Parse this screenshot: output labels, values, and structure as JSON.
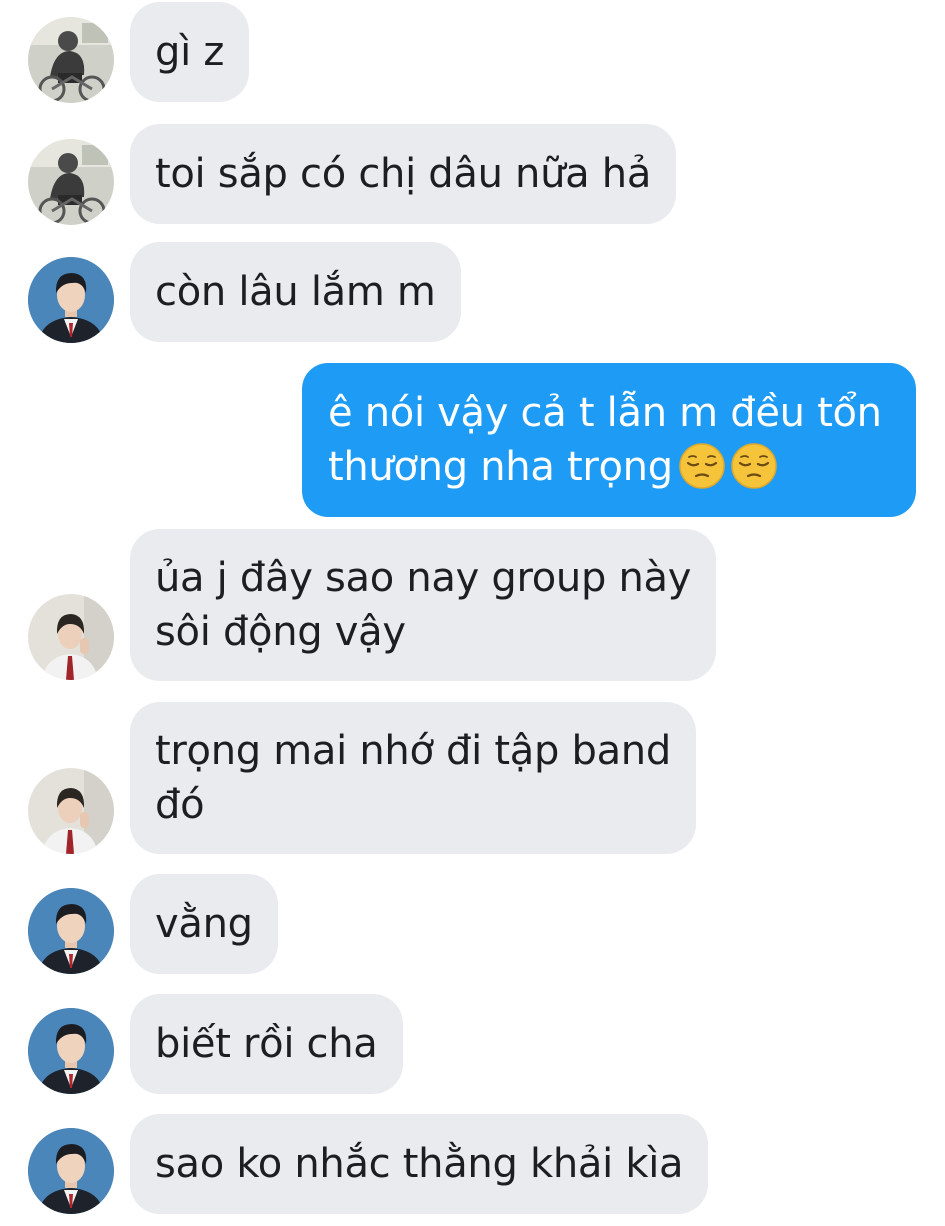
{
  "avatars": {
    "friend_biker": "biker-avatar",
    "trong": "trong-avatar",
    "friend_school": "student-avatar"
  },
  "colors": {
    "incoming_bubble": "#e9ebef",
    "outgoing_bubble": "#1e9cf5"
  },
  "messages": [
    {
      "sender": "friend_biker",
      "text": "gì z"
    },
    {
      "sender": "friend_biker",
      "text": "toi sắp có chị dâu nữa hả"
    },
    {
      "sender": "trong",
      "text": "còn lâu lắm m"
    },
    {
      "sender": "me",
      "lines": [
        "ê nói vậy cả t lẫn m đều tổn",
        "thương nha trọng"
      ],
      "emoji": [
        "pensive-face",
        "pensive-face"
      ]
    },
    {
      "sender": "friend_school",
      "lines": [
        "ủa j đây sao nay group này",
        "sôi động vậy"
      ]
    },
    {
      "sender": "friend_school",
      "lines": [
        "trọng mai nhớ đi tập band",
        "đó"
      ]
    },
    {
      "sender": "trong",
      "text": "vằng"
    },
    {
      "sender": "trong",
      "text": "biết rồi cha"
    },
    {
      "sender": "trong",
      "text": "sao ko nhắc thằng khải kìa"
    }
  ]
}
